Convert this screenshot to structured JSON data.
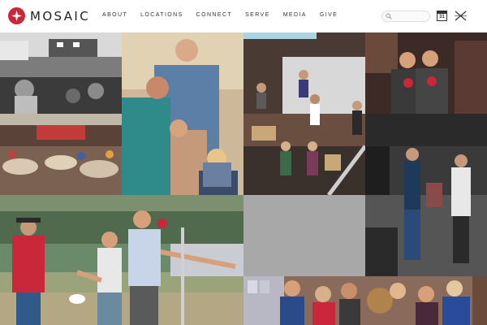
{
  "header": {
    "logo_text": "MOSAIC",
    "nav": [
      "ABOUT",
      "LOCATIONS",
      "CONNECT",
      "SERVE",
      "MEDIA",
      "GIVE"
    ],
    "search_placeholder": "",
    "calendar_day": "31"
  },
  "colors": {
    "brand_red": "#c8283a",
    "text": "#333333"
  },
  "tiles": [
    "worship-gathering-photo",
    "family-portrait-photo",
    "stage-band-photo",
    "team-shirts-photo",
    "dining-hall-photo",
    "conversation-room-photo",
    "frisbee-game-photo",
    "loading-placeholder",
    "group-selfie-photo"
  ]
}
